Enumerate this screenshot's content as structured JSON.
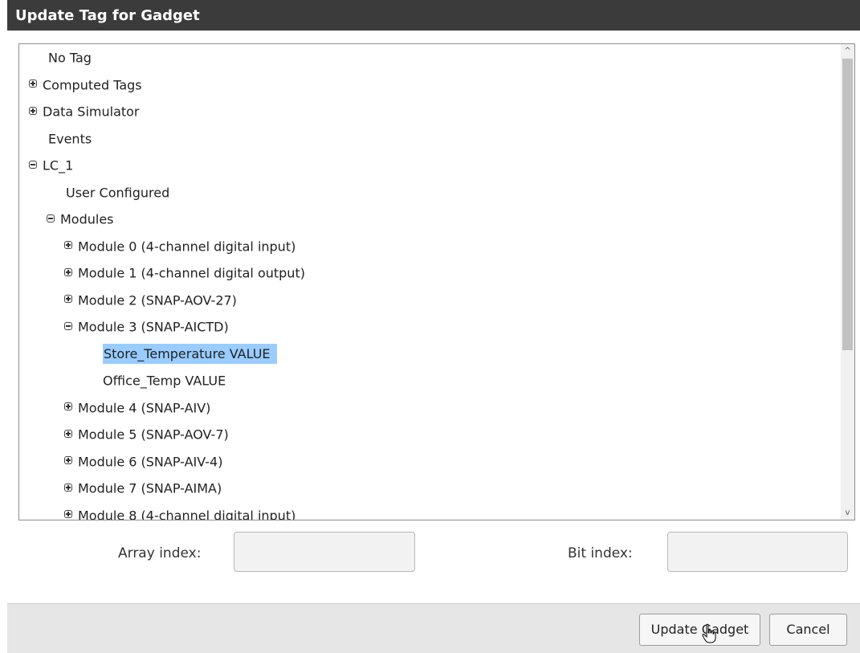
{
  "dialog": {
    "title": "Update Tag for Gadget"
  },
  "tree": {
    "items": [
      {
        "label": "No Tag",
        "toggle": "none",
        "depth": 0
      },
      {
        "label": "Computed Tags",
        "toggle": "plus",
        "depth": 0
      },
      {
        "label": "Data Simulator",
        "toggle": "plus",
        "depth": 0
      },
      {
        "label": "Events",
        "toggle": "none",
        "depth": 0
      },
      {
        "label": "LC_1",
        "toggle": "minus",
        "depth": 0
      },
      {
        "label": "User Configured",
        "toggle": "none",
        "depth": 1
      },
      {
        "label": "Modules",
        "toggle": "minus",
        "depth": 1
      },
      {
        "label": "Module 0 (4-channel digital input)",
        "toggle": "plus",
        "depth": 2
      },
      {
        "label": "Module 1 (4-channel digital output)",
        "toggle": "plus",
        "depth": 2
      },
      {
        "label": "Module 2 (SNAP-AOV-27)",
        "toggle": "plus",
        "depth": 2
      },
      {
        "label": "Module 3 (SNAP-AICTD)",
        "toggle": "minus",
        "depth": 2
      },
      {
        "label": "Store_Temperature VALUE",
        "toggle": "none",
        "depth": 3,
        "selected": true
      },
      {
        "label": "Office_Temp VALUE",
        "toggle": "none",
        "depth": 3
      },
      {
        "label": "Module 4 (SNAP-AIV)",
        "toggle": "plus",
        "depth": 2
      },
      {
        "label": "Module 5 (SNAP-AOV-7)",
        "toggle": "plus",
        "depth": 2
      },
      {
        "label": "Module 6 (SNAP-AIV-4)",
        "toggle": "plus",
        "depth": 2
      },
      {
        "label": "Module 7 (SNAP-AIMA)",
        "toggle": "plus",
        "depth": 2
      },
      {
        "label": "Module 8 (4-channel digital input)",
        "toggle": "plus",
        "depth": 2
      }
    ],
    "selected_color": "#99ccff"
  },
  "fields": {
    "array_index_label": "Array index:",
    "array_index_value": "",
    "bit_index_label": "Bit index:",
    "bit_index_value": ""
  },
  "footer": {
    "update_label": "Update Gadget",
    "cancel_label": "Cancel"
  },
  "colors": {
    "titlebar": "#3b3b3b",
    "footer": "#e6e6e6"
  },
  "icons": {
    "expand": "plus-box-icon",
    "collapse": "minus-box-icon",
    "scroll_up": "chevron-up-icon",
    "scroll_down": "chevron-down-icon",
    "cursor": "hand-pointer-icon"
  }
}
